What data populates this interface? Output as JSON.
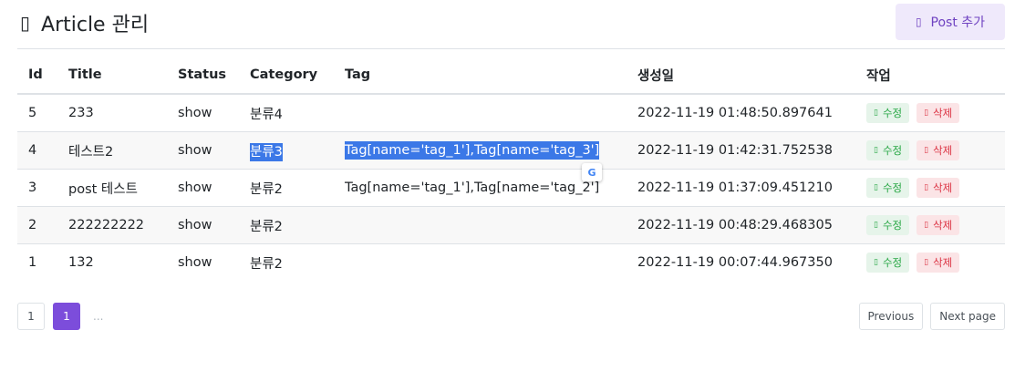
{
  "header": {
    "icon": "document-icon",
    "title": "Article 관리",
    "add_button_label": "Post 추가",
    "add_button_icon": "plus-icon"
  },
  "table": {
    "columns": [
      "Id",
      "Title",
      "Status",
      "Category",
      "Tag",
      "생성일",
      "작업"
    ],
    "rows": [
      {
        "id": "5",
        "title": "233",
        "status": "show",
        "category": "분류4",
        "tag": "",
        "created": "2022-11-19 01:48:50.897641"
      },
      {
        "id": "4",
        "title": "테스트2",
        "status": "show",
        "category": "분류3",
        "tag": "Tag[name='tag_1'],Tag[name='tag_3']",
        "created": "2022-11-19 01:42:31.752538"
      },
      {
        "id": "3",
        "title": "post 테스트",
        "status": "show",
        "category": "분류2",
        "tag": "Tag[name='tag_1'],Tag[name='tag_2']",
        "created": "2022-11-19 01:37:09.451210"
      },
      {
        "id": "2",
        "title": "222222222",
        "status": "show",
        "category": "분류2",
        "tag": "",
        "created": "2022-11-19 00:48:29.468305"
      },
      {
        "id": "1",
        "title": "132",
        "status": "show",
        "category": "분류2",
        "tag": "",
        "created": "2022-11-19 00:07:44.967350"
      }
    ],
    "edit_label": "수정",
    "delete_label": "삭제"
  },
  "pagination": {
    "pages": [
      "1",
      "1"
    ],
    "ellipsis": "...",
    "previous_label": "Previous",
    "next_label": "Next page"
  },
  "colors": {
    "accent": "#7c4ddb",
    "edit": "#28a745",
    "delete": "#dc3545",
    "selection": "#3b78e7"
  }
}
